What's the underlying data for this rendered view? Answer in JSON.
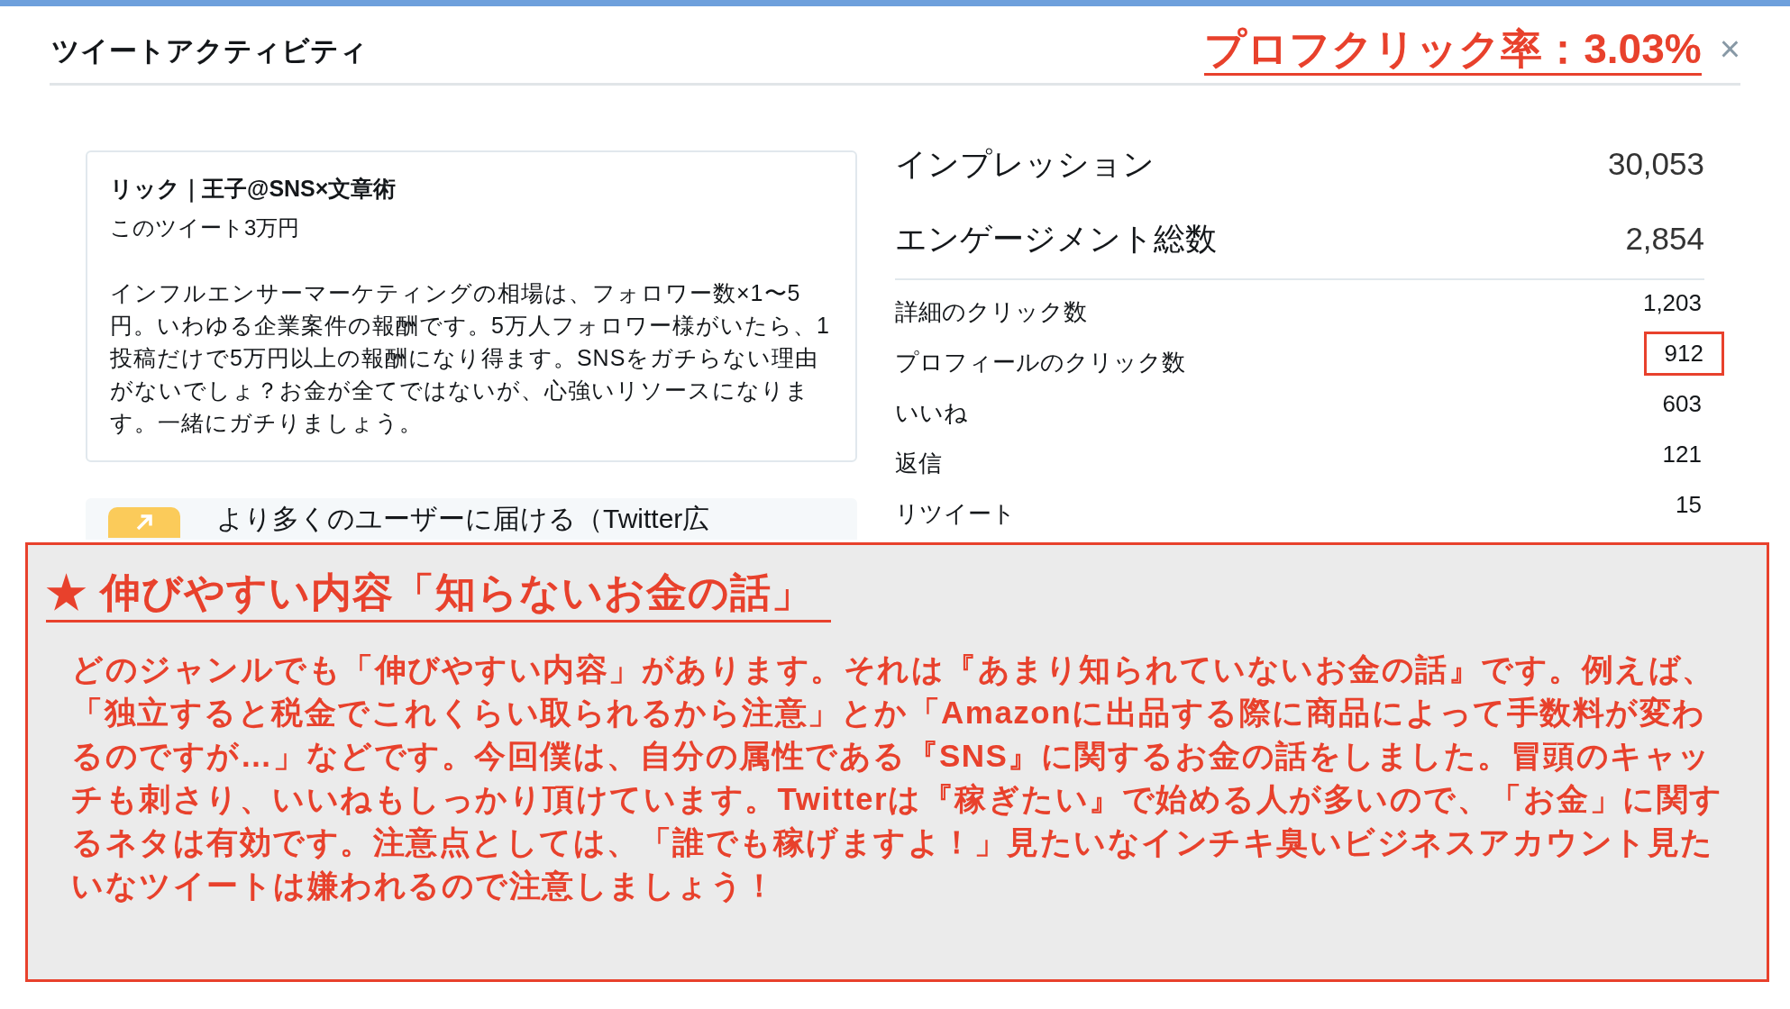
{
  "header": {
    "title": "ツイートアクティビティ",
    "annotation": "プロフクリック率：3.03%",
    "close": "×"
  },
  "tweet": {
    "author": "リック｜王子@SNS×文章術",
    "subtitle": "このツイート3万円",
    "body": "インフルエンサーマーケティングの相場は、フォロワー数×1〜5円。いわゆる企業案件の報酬です。5万人フォロワー様がいたら、1投稿だけで5万円以上の報酬になり得ます。SNSをガチらない理由がないでしょ？お金が全てではないが、心強いリソースになります。一緒にガチりましょう。"
  },
  "promo": {
    "text": "より多くのユーザーに届ける（Twitter広"
  },
  "primary_stats": [
    {
      "label": "インプレッション",
      "value": "30,053"
    },
    {
      "label": "エンゲージメント総数",
      "value": "2,854"
    }
  ],
  "detail_stats": [
    {
      "label": "詳細のクリック数",
      "value": "1,203",
      "highlighted": false
    },
    {
      "label": "プロフィールのクリック数",
      "value": "912",
      "highlighted": true
    },
    {
      "label": "いいね",
      "value": "603",
      "highlighted": false
    },
    {
      "label": "返信",
      "value": "121",
      "highlighted": false
    },
    {
      "label": "リツイート",
      "value": "15",
      "highlighted": false
    }
  ],
  "note": {
    "title": "★ 伸びやすい内容「知らないお金の話」",
    "body": "どのジャンルでも「伸びやすい内容」があります。それは『あまり知られていないお金の話』です。例えば、「独立すると税金でこれくらい取られるから注意」とか「Amazonに出品する際に商品によって手数料が変わるのですが…」などです。今回僕は、自分の属性である『SNS』に関するお金の話をしました。冒頭のキャッチも刺さり、いいねもしっかり頂けています。Twitterは『稼ぎたい』で始める人が多いので、「お金」に関するネタは有効です。注意点としては、「誰でも稼げますよ！」見たいなインチキ臭いビジネスアカウント見たいなツイートは嫌われるので注意しましょう！"
  }
}
